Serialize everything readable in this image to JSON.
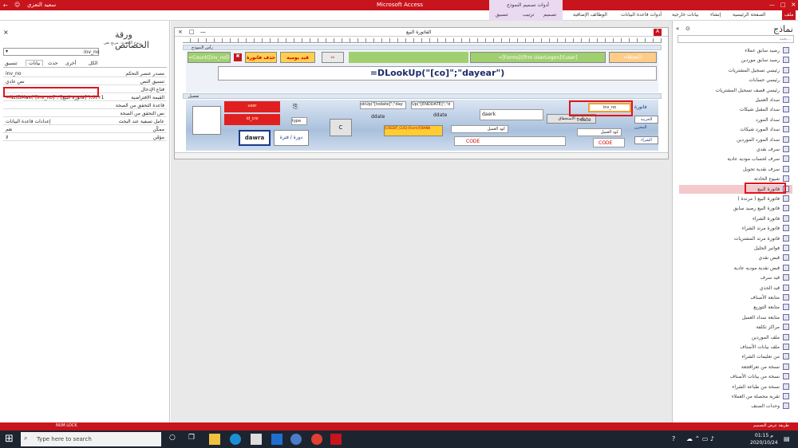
{
  "app": {
    "window_title": "Microsoft Access",
    "user_name": "سعيد التعزي"
  },
  "ribbon": {
    "tabs": [
      "ملف",
      "الصفحة الرئيسية",
      "إنشاء",
      "بيانات خارجية",
      "أدوات قاعدة البيانات",
      "الوظائف الإضافية",
      "تصميم",
      "ترتيب",
      "تنسيق"
    ],
    "context_group": "أدوات تصميم النموذج"
  },
  "property_sheet": {
    "title": "ورقة الخصائص",
    "selection_type_label": "نوع التحديد: مربع نص",
    "selected_control": "inv_no",
    "tabs": [
      "الكل",
      "أخرى",
      "حدث",
      "بيانات",
      "تنسيق"
    ],
    "active_tab": "بيانات",
    "rows": [
      {
        "label": "مصدر عنصر التحكم",
        "value": "inv_no"
      },
      {
        "label": "تنسيق النص",
        "value": "نص عادي"
      },
      {
        "label": "قناع الإدخال",
        "value": ""
      },
      {
        "label": "القيمة الافتراضية",
        "value": "=Nz(DMax(\"[inv_no]\";\"[فاتورة البيع]\");0)+1"
      },
      {
        "label": "قاعدة التحقق من الصحة",
        "value": ""
      },
      {
        "label": "نص التحقق من الصحة",
        "value": ""
      },
      {
        "label": "عامل تصفية عند البحث",
        "value": "إعدادات قاعدة البيانات"
      },
      {
        "label": "ممكّن",
        "value": "نعم"
      },
      {
        "label": "مؤمّن",
        "value": "لا"
      }
    ]
  },
  "form": {
    "tab_title": "الفاتورة البيع",
    "header_label": "رأس النموذج",
    "detail_label": "تفصيل",
    "buttons": {
      "now": "=Now()",
      "user_lookup": "=[Forms]![frm UserLogon]![user]",
      "daily": "قيد يومية",
      "delete_invoice": "حذف فاتورة",
      "new_record": "=Count([inv_no])"
    },
    "dlookup_expr": "=DLookUp(\"[co]\";\"dayear\")",
    "fields": {
      "inv_no": "inv_no",
      "invoice_label": "فاتورة",
      "date_label": "date",
      "treasury_label": "الخزينة",
      "warehouse_label": "المخزن",
      "store_label": "الشراء",
      "customer_code_label": "كود العميل",
      "dawra_btn": "dawra",
      "period_label": "دورة / فترة",
      "type_label": "type",
      "code1": "CODE",
      "code2": "CODE",
      "ddate": "ddate",
      "ddate2": "ddate",
      "daerk": "daerk",
      "expr1": "okUp(\"[todate]\";\"day",
      "expr2": "Up(\"[ENDDATE]\";\"d",
      "expr3": "[CREDIT_CUS]-[Form]![BANK",
      "user_red": "user",
      "id_red": "id_cre",
      "c_btn": "C",
      "nature_label": "تاريخ الاستحقاق"
    }
  },
  "nav_pane": {
    "title": "نماذج",
    "search_placeholder": "بحث...",
    "items": [
      "رصيد سابق عملاء",
      "رصيد سابق موردين",
      "رئيسي تسجيل المشتريات",
      "رئيسي حسابات",
      "رئيسي قصف تسجيل المشتريات",
      "سداد العميل",
      "سداد المقبل شيكات",
      "سداد المورد",
      "سداد المورد شيكات",
      "سداد المورد الموردين",
      "سرف نقدي",
      "سرف لحساب موديه عادية",
      "سرف نقدية تحويل",
      "شيوع الحادثة",
      "فاتورة البيع",
      "فاتورة البيع ( مرتدة )",
      "فاتورة البيع رصيد سابق",
      "فاتورة الشراء",
      "فاتورة مرتد الشراء",
      "فاتورة مرتد المشتريات",
      "فواتير الحليل",
      "قبض نقدي",
      "قبض نقدية موديه عادية",
      "قيد سرف",
      "قيد الحذي",
      "متابعة الأصناف",
      "متابعة التوزيع",
      "متابعة سداد العميل",
      "مراكز تكلفة",
      "ملف الموردين",
      "ملف بيانات الأصناف",
      "من تعليمات الشراء",
      "نسخة من تعراقجعة",
      "نسخة من بيانات الأصناف",
      "نسخة من طباعة الشراء",
      "تقرية محصلة من العملاء",
      "وحدات الصنف"
    ],
    "selected": "فاتورة البيع"
  },
  "status": {
    "left": "NUM LOCK",
    "right": "طريقة عرض التصميم"
  },
  "taskbar": {
    "search_placeholder": "Type here to search",
    "time": "01:15 م",
    "date": "2020/10/24"
  }
}
